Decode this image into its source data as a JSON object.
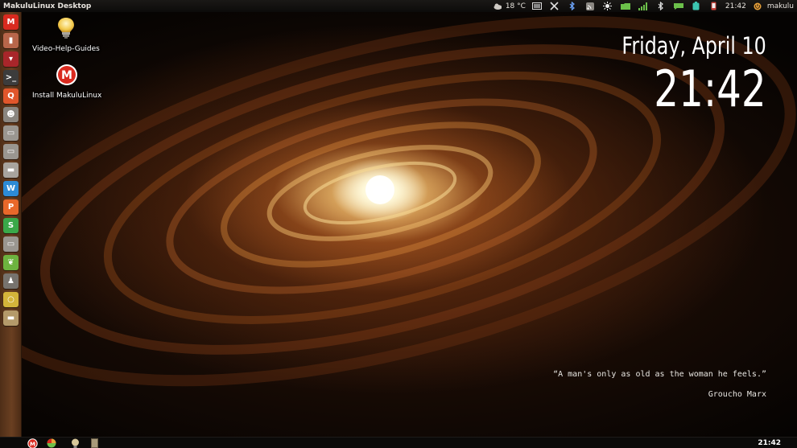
{
  "top_panel": {
    "window_title": "MakuluLinux Desktop",
    "weather_temp": "18 °C",
    "time": "21:42",
    "user": "makulu"
  },
  "desktop_icons": [
    {
      "label": "Video-Help-Guides",
      "icon": "lightbulb-icon"
    },
    {
      "label": "Install MakuluLinux",
      "icon": "makulu-logo-icon"
    }
  ],
  "launcher": {
    "items": [
      {
        "name": "makulu-menu",
        "color": "#d92a1f",
        "glyph": "M"
      },
      {
        "name": "trash",
        "color": "#b8664a",
        "glyph": "▮"
      },
      {
        "name": "software-center",
        "color": "#a8262a",
        "glyph": "▾"
      },
      {
        "name": "terminal",
        "color": "#3c3c3c",
        "glyph": ">_"
      },
      {
        "name": "search",
        "color": "#e0562b",
        "glyph": "Q"
      },
      {
        "name": "user-accounts",
        "color": "#8a8680",
        "glyph": "☻"
      },
      {
        "name": "drive-1",
        "color": "#9a9690",
        "glyph": "▭"
      },
      {
        "name": "drive-2",
        "color": "#9a9690",
        "glyph": "▭"
      },
      {
        "name": "drive-3",
        "color": "#a8a49e",
        "glyph": "▬"
      },
      {
        "name": "writer",
        "color": "#2d8bd6",
        "glyph": "W"
      },
      {
        "name": "presentation",
        "color": "#e8682a",
        "glyph": "P"
      },
      {
        "name": "spreadsheet",
        "color": "#3aa849",
        "glyph": "S"
      },
      {
        "name": "drive-4",
        "color": "#9a9690",
        "glyph": "▭"
      },
      {
        "name": "leaf-app",
        "color": "#6db33f",
        "glyph": "❦"
      },
      {
        "name": "network",
        "color": "#77736e",
        "glyph": "♟"
      },
      {
        "name": "search-tool",
        "color": "#d4b43a",
        "glyph": "○"
      },
      {
        "name": "drive-5",
        "color": "#b49a6a",
        "glyph": "▬"
      }
    ]
  },
  "conky": {
    "date": "Friday, April 10",
    "time": "21:42",
    "quote": "“A man's only as old as the woman he feels.”",
    "author": "Groucho Marx"
  },
  "bottom_panel": {
    "time": "21:42"
  },
  "colors": {
    "accent_red": "#d92a1f",
    "panel_bg": "#0c0b0a",
    "launcher_bg": "#5e3820"
  }
}
